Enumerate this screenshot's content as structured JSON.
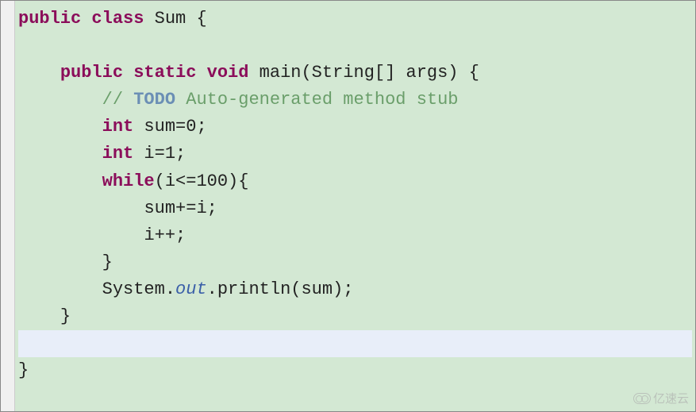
{
  "code": {
    "line1": {
      "kw_public": "public",
      "kw_class": "class",
      "cls": "Sum",
      "brace": " {"
    },
    "line2": "",
    "line3": {
      "indent": "    ",
      "kw_public": "public",
      "kw_static": "static",
      "kw_void": "void",
      "method": " main(String[] args) {"
    },
    "line4": {
      "indent": "        ",
      "comment_prefix": "// ",
      "todo": "TODO",
      "comment_rest": " Auto-generated method stub"
    },
    "line5": {
      "indent": "        ",
      "kw_int": "int",
      "rest": " sum=0;"
    },
    "line6": {
      "indent": "        ",
      "kw_int": "int",
      "rest": " i=1;"
    },
    "line7": {
      "indent": "        ",
      "kw_while": "while",
      "rest": "(i<=100){"
    },
    "line8": {
      "indent": "            ",
      "text": "sum+=i;"
    },
    "line9": {
      "indent": "            ",
      "text": "i++;"
    },
    "line10": {
      "indent": "        ",
      "text": "}"
    },
    "line11": {
      "indent": "        ",
      "sys": "System.",
      "out": "out",
      "rest": ".println(sum);"
    },
    "line12": {
      "indent": "    ",
      "text": "}"
    },
    "line13": "",
    "line14": {
      "text": "}"
    }
  },
  "watermark": "亿速云"
}
